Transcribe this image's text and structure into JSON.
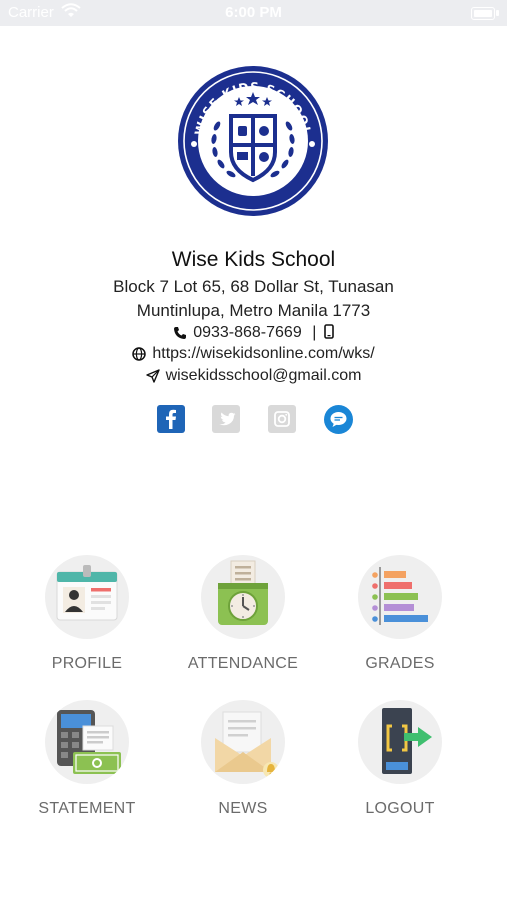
{
  "status_bar": {
    "carrier": "Carrier",
    "time": "6:00 PM"
  },
  "school": {
    "name": "Wise Kids School",
    "logo_text": "WISE KIDS SCHOOL",
    "address_line1": "Block 7 Lot 65, 68 Dollar St, Tunasan",
    "address_line2": "Muntinlupa, Metro Manila 1773",
    "phone": "0933-868-7669",
    "phone_separator": "|",
    "website": "https://wisekidsonline.com/wks/",
    "email": "wisekidsschool@gmail.com"
  },
  "social": [
    "facebook",
    "twitter",
    "instagram",
    "messenger"
  ],
  "colors": {
    "brand_blue": "#1c2f8f",
    "facebook": "#1f65b7",
    "messenger": "#1a86d6",
    "label_gray": "#6b6b6b"
  },
  "menu": [
    {
      "label": "PROFILE",
      "icon": "id-card-icon"
    },
    {
      "label": "ATTENDANCE",
      "icon": "time-clock-icon"
    },
    {
      "label": "GRADES",
      "icon": "bar-chart-icon"
    },
    {
      "label": "STATEMENT",
      "icon": "calculator-money-icon"
    },
    {
      "label": "NEWS",
      "icon": "envelope-icon"
    },
    {
      "label": "LOGOUT",
      "icon": "logout-door-icon"
    }
  ]
}
